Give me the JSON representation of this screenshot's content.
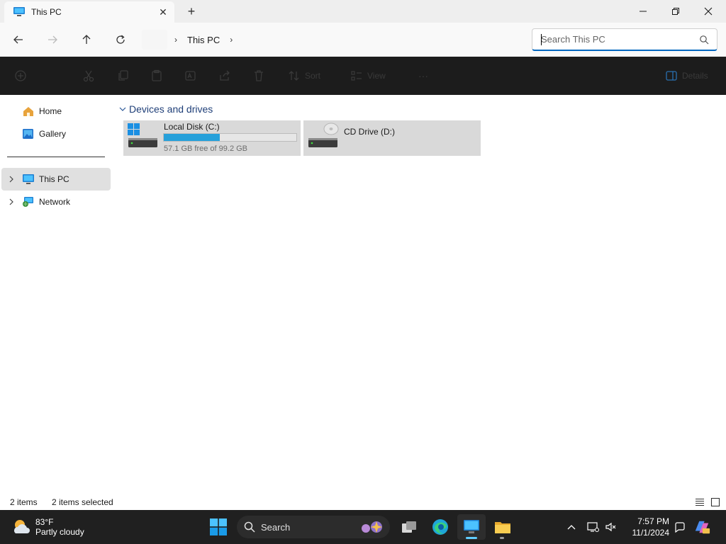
{
  "window": {
    "tab_title": "This PC",
    "new_tab_symbol": "+",
    "close_tab_symbol": "✕"
  },
  "address": {
    "crumbs": [
      "This PC"
    ],
    "search_placeholder": "Search This PC"
  },
  "command_bar": {
    "items": [
      {
        "icon": "new-icon",
        "label": ""
      },
      {
        "icon": "cut-icon",
        "label": ""
      },
      {
        "icon": "copy-icon",
        "label": ""
      },
      {
        "icon": "paste-icon",
        "label": ""
      },
      {
        "icon": "rename-icon",
        "label": ""
      },
      {
        "icon": "share-icon",
        "label": ""
      },
      {
        "icon": "delete-icon",
        "label": ""
      },
      {
        "icon": "sort-icon",
        "label": "Sort"
      },
      {
        "icon": "view-icon",
        "label": "View"
      },
      {
        "icon": "more-icon",
        "label": "···"
      },
      {
        "icon": "details-icon",
        "label": "Details"
      }
    ]
  },
  "nav": {
    "items": [
      {
        "label": "Home",
        "icon": "home-icon"
      },
      {
        "label": "Gallery",
        "icon": "gallery-icon"
      },
      {
        "label": "This PC",
        "icon": "computer-icon",
        "selected": true
      },
      {
        "label": "Network",
        "icon": "network-icon"
      }
    ]
  },
  "content": {
    "group_title": "Devices and drives",
    "drives": [
      {
        "name": "Local Disk (C:)",
        "free_text": "57.1 GB free of 99.2 GB",
        "used_fraction": 0.4244,
        "icon": "windows-drive-icon"
      },
      {
        "name": "CD Drive (D:)",
        "free_text": "",
        "icon": "cd-drive-icon"
      }
    ]
  },
  "status": {
    "item_count": "2 items",
    "selection": "2 items selected"
  },
  "taskbar": {
    "weather_temp": "83°F",
    "weather_desc": "Partly cloudy",
    "search_label": "Search",
    "time": "7:57 PM",
    "date": "11/1/2024",
    "colors": {
      "accent": "#60cdff",
      "bar_fill": "#26a0da",
      "taskbar_bg": "#202020"
    }
  }
}
